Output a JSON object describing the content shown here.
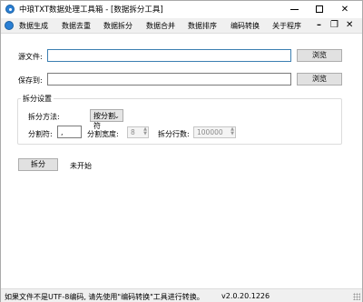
{
  "window": {
    "title": "中琅TXT数据处理工具箱 - [数据拆分工具]",
    "min_glyph": "",
    "max_glyph": "",
    "close_glyph": "✕"
  },
  "menu": {
    "items": [
      "数据生成",
      "数据去重",
      "数据拆分",
      "数据合并",
      "数据排序",
      "编码转换",
      "关于程序"
    ],
    "mdi_min": "–",
    "mdi_restore": "❐",
    "mdi_close": "✕"
  },
  "source": {
    "label": "源文件:",
    "value": "",
    "browse": "浏览"
  },
  "target": {
    "label": "保存到:",
    "value": "",
    "browse": "浏览"
  },
  "settings": {
    "title": "拆分设置",
    "method_label": "拆分方法:",
    "method_value": "按分割符",
    "separator_label": "分割符:",
    "separator_value": ",",
    "width_label": "分割宽度:",
    "width_value": "8",
    "rows_label": "拆分行数:",
    "rows_value": "100000"
  },
  "action": {
    "split_button": "拆分",
    "status": "未开始"
  },
  "statusbar": {
    "hint": "如果文件不是UTF-8编码, 请先使用\"编码转换\"工具进行转换。",
    "version": "v2.0.20.1226"
  },
  "colors": {
    "accent": "#2a7fd4",
    "input_border_focus": "#3c7fb1"
  }
}
